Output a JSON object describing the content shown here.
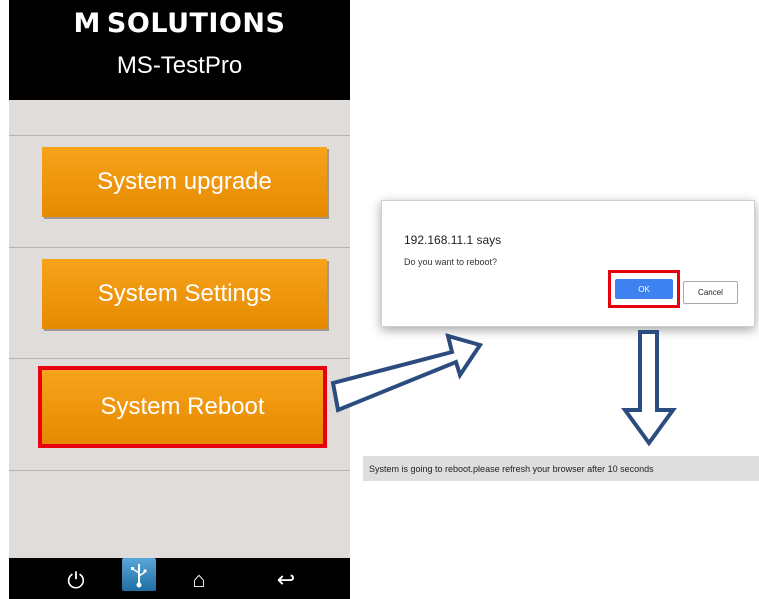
{
  "device": {
    "brand": "SOLUTIONS",
    "brand_prefix": "M",
    "product": "MS-TestPro",
    "buttons": [
      {
        "label": "System upgrade"
      },
      {
        "label": "System Settings"
      },
      {
        "label": "System Reboot"
      }
    ],
    "nav": {
      "power": "⏻",
      "usb": "USB",
      "home": "⌂",
      "back": "↩"
    }
  },
  "dialog": {
    "title": "192.168.11.1 says",
    "message": "Do you want to reboot?",
    "ok_label": "OK",
    "cancel_label": "Cancel"
  },
  "status": {
    "text": "System is going to reboot.please refresh your browser after 10 seconds"
  },
  "colors": {
    "button_orange": "#f39c12",
    "highlight_red": "#e8000e",
    "ok_blue": "#3d82f0",
    "arrow_blue": "#2b4c7e"
  }
}
